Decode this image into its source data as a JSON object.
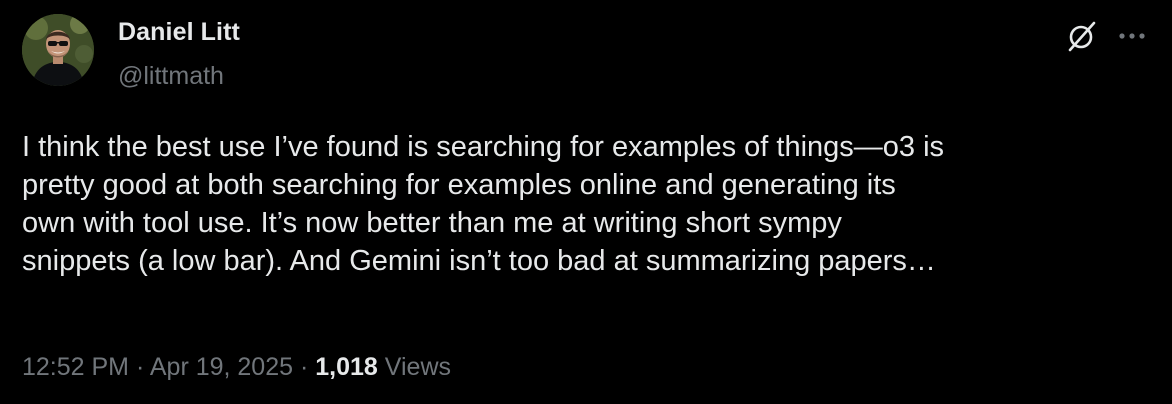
{
  "author": {
    "name": "Daniel Litt",
    "handle": "@littmath"
  },
  "tweet": {
    "lines": [
      "I think the best use I’ve found is searching for examples of things—o3 is",
      "pretty good at both searching for examples online and generating its",
      "own with tool use. It’s now better than me at writing short sympy",
      "snippets (a low bar). And Gemini isn’t too bad at summarizing papers…"
    ]
  },
  "meta": {
    "time": "12:52 PM",
    "separator": " · ",
    "date": "Apr 19, 2025",
    "views_count": "1,018",
    "views_label": " Views"
  },
  "icons": {
    "grok": "grok-icon",
    "more": "more-icon"
  },
  "colors": {
    "background": "#000000",
    "primary_text": "#e7e9ea",
    "secondary_text": "#71767b"
  }
}
